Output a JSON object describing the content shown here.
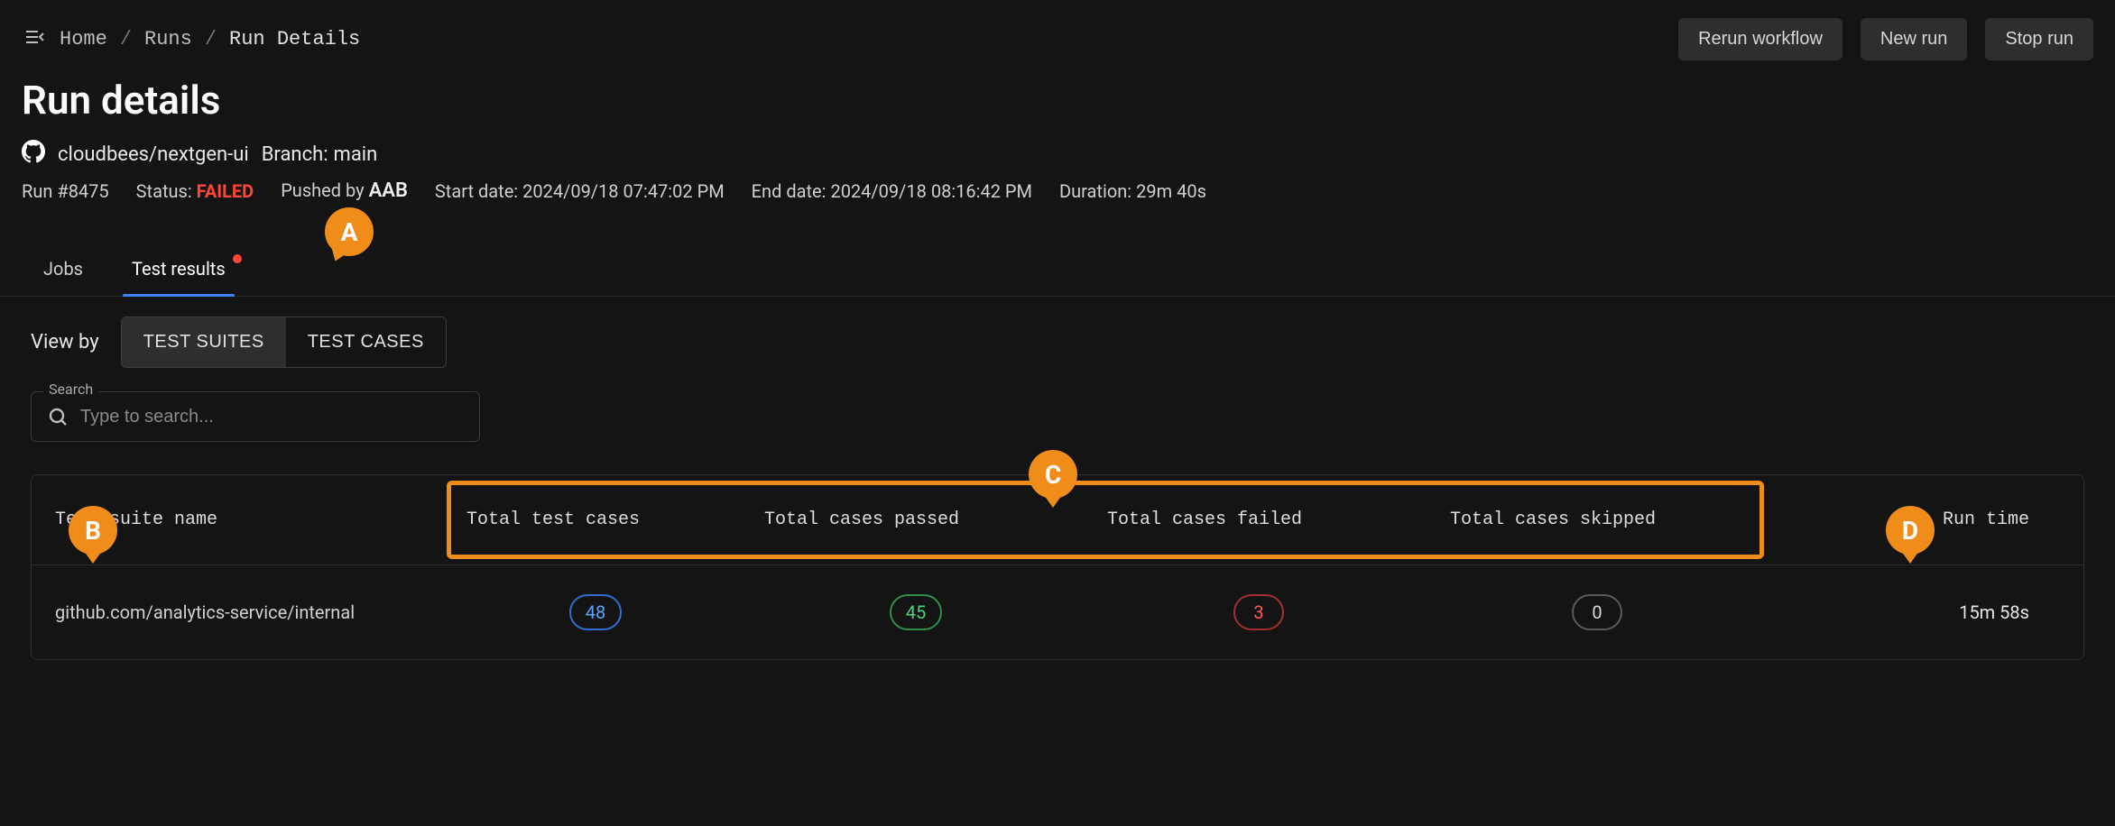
{
  "breadcrumb": {
    "home": "Home",
    "runs": "Runs",
    "current": "Run Details"
  },
  "actions": {
    "rerun": "Rerun workflow",
    "new_run": "New run",
    "stop_run": "Stop run"
  },
  "page_title": "Run details",
  "repo": {
    "path": "cloudbees/nextgen-ui",
    "branch_label": "Branch:",
    "branch": "main"
  },
  "meta": {
    "run_label": "Run",
    "run_number": "#8475",
    "status_label": "Status:",
    "status_value": "FAILED",
    "pushed_by_label": "Pushed by",
    "pushed_by_value": "AAB",
    "start_label": "Start date:",
    "start_value": "2024/09/18 07:47:02 PM",
    "end_label": "End date:",
    "end_value": "2024/09/18 08:16:42 PM",
    "duration_label": "Duration:",
    "duration_value": "29m 40s"
  },
  "tabs": {
    "jobs": "Jobs",
    "test_results": "Test results"
  },
  "callouts": {
    "a": "A",
    "b": "B",
    "c": "C",
    "d": "D"
  },
  "viewby": {
    "label": "View by",
    "suites": "TEST SUITES",
    "cases": "TEST CASES"
  },
  "search": {
    "legend": "Search",
    "placeholder": "Type to search..."
  },
  "columns": {
    "suite": "Test suite name",
    "total": "Total test cases",
    "passed": "Total cases passed",
    "failed": "Total cases failed",
    "skipped": "Total cases skipped",
    "runtime": "Run time"
  },
  "rows": [
    {
      "suite": "github.com/analytics-service/internal",
      "total": "48",
      "passed": "45",
      "failed": "3",
      "skipped": "0",
      "runtime": "15m 58s"
    }
  ]
}
